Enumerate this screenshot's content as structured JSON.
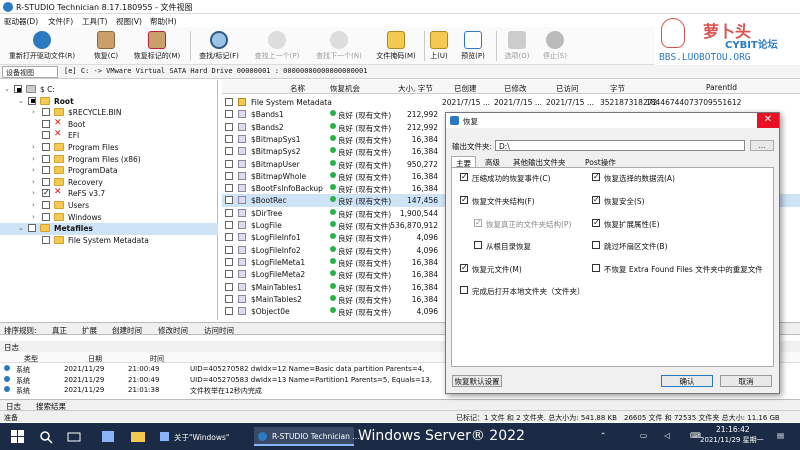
{
  "window": {
    "title": "R-STUDIO Technician 8.17.180955 - 文件视图"
  },
  "menu": [
    "驱动器(D)",
    "文件(F)",
    "工具(T)",
    "视图(V)",
    "帮助(H)"
  ],
  "toolbar": [
    {
      "label": "重新打开驱动文件(R)",
      "icon": "refresh-icon",
      "enabled": true
    },
    {
      "label": "恢复(C)",
      "icon": "recover-icon",
      "enabled": true
    },
    {
      "label": "恢复标记的(M)",
      "icon": "recover-marked-icon",
      "enabled": true
    },
    {
      "label": "查找/标记(F)",
      "icon": "find-icon",
      "enabled": true
    },
    {
      "label": "查找上一个(P)",
      "icon": "find-prev-icon",
      "enabled": false
    },
    {
      "label": "查找下一个(N)",
      "icon": "find-next-icon",
      "enabled": false
    },
    {
      "label": "文件掩码(M)",
      "icon": "file-mask-icon",
      "enabled": true
    },
    {
      "label": "上(U)",
      "icon": "up-icon",
      "enabled": true
    },
    {
      "label": "预览(P)",
      "icon": "preview-icon",
      "enabled": true
    },
    {
      "label": "选项(O)",
      "icon": "options-icon",
      "enabled": false
    },
    {
      "label": "停止(S)",
      "icon": "stop-icon",
      "enabled": false
    }
  ],
  "logo": {
    "text": "萝卜头",
    "sub1": "CYBIT论坛",
    "sub2": "BBS.LUOBOTOU.ORG"
  },
  "address": {
    "tab": "设备视图",
    "path": "[e] C: -> VMware Virtual SATA Hard Drive 00000001 : 00000000000000000001"
  },
  "tree": [
    {
      "label": "$ C:",
      "level": 0,
      "check": "part",
      "icon": "drive"
    },
    {
      "label": "Root",
      "level": 1,
      "check": "part",
      "icon": "folder",
      "bold": true
    },
    {
      "label": "$RECYCLE.BIN",
      "level": 2,
      "check": "none",
      "icon": "folder"
    },
    {
      "label": "Boot",
      "level": 2,
      "check": "none",
      "icon": "x"
    },
    {
      "label": "EFI",
      "level": 2,
      "check": "none",
      "icon": "x"
    },
    {
      "label": "Program Files",
      "level": 2,
      "check": "none",
      "icon": "folder"
    },
    {
      "label": "Program Files (x86)",
      "level": 2,
      "check": "none",
      "icon": "folder"
    },
    {
      "label": "ProgramData",
      "level": 2,
      "check": "none",
      "icon": "folder"
    },
    {
      "label": "Recovery",
      "level": 2,
      "check": "none",
      "icon": "folder"
    },
    {
      "label": "ReFS v3.7",
      "level": 2,
      "check": "chk",
      "icon": "x"
    },
    {
      "label": "Users",
      "level": 2,
      "check": "none",
      "icon": "folder"
    },
    {
      "label": "Windows",
      "level": 2,
      "check": "none",
      "icon": "folder"
    },
    {
      "label": "Metafiles",
      "level": 1,
      "check": "none",
      "icon": "folder",
      "bold": true,
      "selected": true
    },
    {
      "label": "File System Metadata",
      "level": 2,
      "check": "none",
      "icon": "folder"
    }
  ],
  "file_columns": [
    "名称",
    "恢复机会",
    "大小, 字节",
    "已创建",
    "已修改",
    "已访问",
    "字节",
    "ParentId"
  ],
  "files": [
    {
      "name": "File System Metadata",
      "chance": "",
      "size": "",
      "created": "2021/7/15 ...",
      "modified": "2021/7/15 ...",
      "accessed": "2021/7/15 ...",
      "bytes": "352187318272",
      "parent": "18446744073709551612",
      "folder": true
    },
    {
      "name": "$Bands1",
      "chance": "良好 (现有文件)",
      "size": "212,992"
    },
    {
      "name": "$Bands2",
      "chance": "良好 (现有文件)",
      "size": "212,992"
    },
    {
      "name": "$BitmapSys1",
      "chance": "良好 (现有文件)",
      "size": "16,384"
    },
    {
      "name": "$BitmapSys2",
      "chance": "良好 (现有文件)",
      "size": "16,384"
    },
    {
      "name": "$BitmapUser",
      "chance": "良好 (现有文件)",
      "size": "950,272"
    },
    {
      "name": "$BitmapWhole",
      "chance": "良好 (现有文件)",
      "size": "16,384"
    },
    {
      "name": "$BootFsInfoBackup",
      "chance": "良好 (现有文件)",
      "size": "16,384"
    },
    {
      "name": "$BootRec",
      "chance": "良好 (现有文件)",
      "size": "147,456",
      "selected": true
    },
    {
      "name": "$DirTree",
      "chance": "良好 (现有文件)",
      "size": "1,900,544"
    },
    {
      "name": "$LogFile",
      "chance": "良好 (现有文件)",
      "size": "536,870,912"
    },
    {
      "name": "$LogFileInfo1",
      "chance": "良好 (现有文件)",
      "size": "4,096"
    },
    {
      "name": "$LogFileInfo2",
      "chance": "良好 (现有文件)",
      "size": "4,096"
    },
    {
      "name": "$LogFileMeta1",
      "chance": "良好 (现有文件)",
      "size": "16,384"
    },
    {
      "name": "$LogFileMeta2",
      "chance": "良好 (现有文件)",
      "size": "16,384"
    },
    {
      "name": "$MainTables1",
      "chance": "良好 (现有文件)",
      "size": "16,384"
    },
    {
      "name": "$MainTables2",
      "chance": "良好 (现有文件)",
      "size": "16,384"
    },
    {
      "name": "$Object0e",
      "chance": "良好 (现有文件)",
      "size": "4,096"
    }
  ],
  "prop_tabs": [
    "排序规则:",
    "真正",
    "扩展",
    "创建时间",
    "修改时间",
    "访问时间"
  ],
  "log": {
    "title": "日志",
    "columns": [
      "类型",
      "日期",
      "时间",
      "文本"
    ],
    "rows": [
      {
        "type": "系统",
        "date": "2021/11/29",
        "time": "21:00:49",
        "text": "UID=405270582 dwIdx=12 Name=Basic data partition  Parents=4,"
      },
      {
        "type": "系统",
        "date": "2021/11/29",
        "time": "21:00:49",
        "text": "UID=405270583 dwIdx=13 Name=Partition1  Parents=5,  Equals=13,"
      },
      {
        "type": "系统",
        "date": "2021/11/29",
        "time": "21:01:38",
        "text": "文件枚举在12秒内完成"
      }
    ],
    "tabs": [
      "日志",
      "搜索结果"
    ]
  },
  "status": {
    "left": "准备",
    "marked": "已标记：1 文件 和 2 文件夹. 总大小为: 541.88 KB",
    "total": "26605 文件 和 72535 文件夹 总大小: 11.16 GB"
  },
  "dialog": {
    "title": "恢复",
    "output_label": "输出文件夹:",
    "output_value": "D:\\",
    "browse": "...",
    "tabs": [
      "主要",
      "高级",
      "其他输出文件夹",
      "Post操作"
    ],
    "options": [
      {
        "label": "压缩成功的恢复事件(C)",
        "checked": true
      },
      {
        "label": "恢复选择的数据流(A)",
        "checked": true
      },
      {
        "label": "恢复文件夹结构(F)",
        "checked": true
      },
      {
        "label": "恢复安全(S)",
        "checked": true
      },
      {
        "label": "恢复真正的文件夹结构(P)",
        "checked": true,
        "disabled": true
      },
      {
        "label": "恢复扩展属性(E)",
        "checked": true
      },
      {
        "label": "从根目录恢复",
        "checked": false
      },
      {
        "label": "跳过坏扇区文件(B)",
        "checked": false
      },
      {
        "label": "恢复元文件(M)",
        "checked": true
      },
      {
        "label": "不恢复 Extra Found Files 文件夹中的重复文件",
        "checked": false
      },
      {
        "label": "完成后打开本地文件夹（文件夹）",
        "checked": false
      }
    ],
    "default_btn": "恢复默认设置",
    "ok": "确认",
    "cancel": "取消"
  },
  "taskbar": {
    "items": [
      "关于\"Windows\"",
      "R-STUDIO Technician ..."
    ],
    "os_label": "Windows Server® 2022",
    "clock_time": "21:16:42",
    "clock_date": "2021/11/29 星期一"
  }
}
